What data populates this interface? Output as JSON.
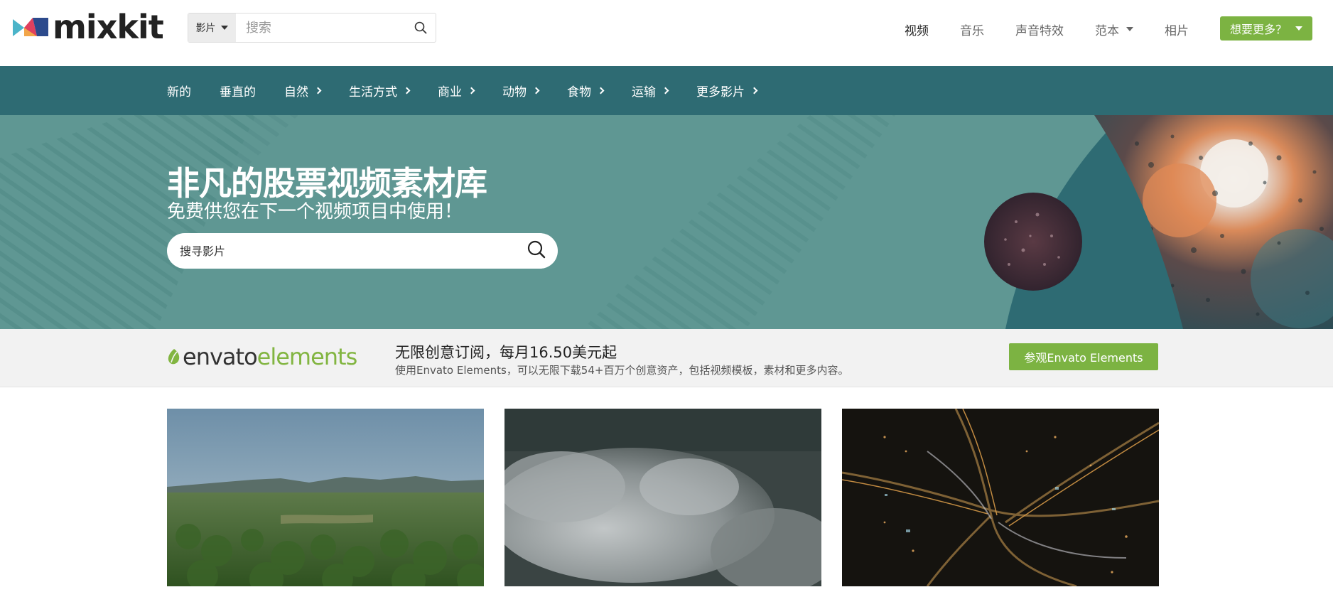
{
  "header": {
    "logo_text": "mixkit",
    "search": {
      "type_label": "影片",
      "placeholder": "搜索"
    },
    "nav": [
      {
        "label": "视频",
        "active": true
      },
      {
        "label": "音乐"
      },
      {
        "label": "声音特效"
      },
      {
        "label": "范本",
        "dropdown": true
      },
      {
        "label": "相片"
      }
    ],
    "want_more_label": "想要更多？"
  },
  "categories": [
    {
      "label": "新的"
    },
    {
      "label": "垂直的"
    },
    {
      "label": "自然",
      "has_children": true
    },
    {
      "label": "生活方式",
      "has_children": true
    },
    {
      "label": "商业",
      "has_children": true
    },
    {
      "label": "动物",
      "has_children": true
    },
    {
      "label": "食物",
      "has_children": true
    },
    {
      "label": "运输",
      "has_children": true
    },
    {
      "label": "更多影片",
      "has_children": true
    }
  ],
  "hero": {
    "title": "非凡的股票视频素材库",
    "subtitle": "免费供您在下一个视频项目中使用！",
    "search_placeholder": "搜寻影片"
  },
  "envato": {
    "logo_part1": "envato",
    "logo_part2": "elements",
    "title": "无限创意订阅，每月16.50美元起",
    "description": "使用Envato Elements，可以无限下载54+百万个创意资产，包括视频模板，素材和更多内容。",
    "button_label": "参观Envato Elements"
  },
  "colors": {
    "brand_green": "#7cb342",
    "category_bar": "#2e6b73",
    "hero_bg": "#5f9793"
  },
  "videos": [
    {
      "scene": "forest-landscape"
    },
    {
      "scene": "clouds-over-forest"
    },
    {
      "scene": "city-night-aerial"
    }
  ]
}
